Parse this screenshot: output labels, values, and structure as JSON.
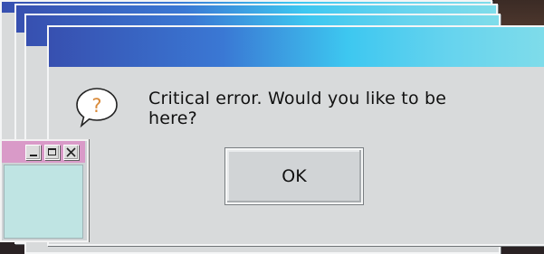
{
  "dialog": {
    "message": "Critical error. Would you like to be here?",
    "ok_label": "OK",
    "icon": "question-bubble-icon"
  },
  "colors": {
    "titlebar_start": "#3750b0",
    "titlebar_mid": "#3dc7f0",
    "titlebar_end": "#7fdcea",
    "window_body": "#d8dadb",
    "mini_titlebar": "#d99ac8",
    "mini_body": "#bfe4e3",
    "icon_question_mark": "#d98a3a"
  },
  "mini_window": {
    "controls": [
      "minimize-icon",
      "maximize-icon",
      "close-icon"
    ]
  }
}
